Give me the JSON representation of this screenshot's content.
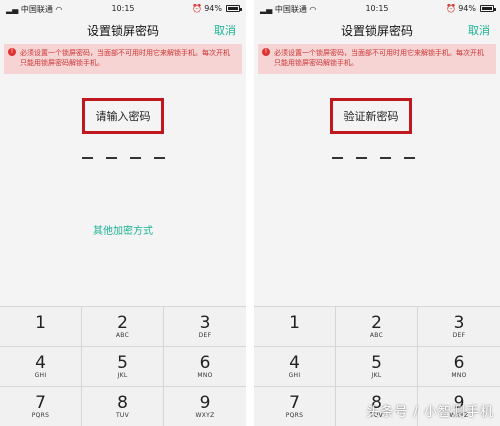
{
  "left": {
    "status": {
      "carrier": "中国联通",
      "time": "10:15",
      "battery": "94%"
    },
    "title": "设置锁屏密码",
    "cancel": "取消",
    "warning": "必须设置一个锁屏密码，当面部不可用时用它来解锁手机。每次开机只能用锁屏密码解锁手机。",
    "prompt": "请输入密码",
    "other_methods": "其他加密方式",
    "keys": [
      {
        "num": "1",
        "letters": ""
      },
      {
        "num": "2",
        "letters": "ABC"
      },
      {
        "num": "3",
        "letters": "DEF"
      },
      {
        "num": "4",
        "letters": "GHI"
      },
      {
        "num": "5",
        "letters": "JKL"
      },
      {
        "num": "6",
        "letters": "MNO"
      },
      {
        "num": "7",
        "letters": "PQRS"
      },
      {
        "num": "8",
        "letters": "TUV"
      },
      {
        "num": "9",
        "letters": "WXYZ"
      }
    ]
  },
  "right": {
    "status": {
      "carrier": "中国联通",
      "time": "10:15",
      "battery": "94%"
    },
    "title": "设置锁屏密码",
    "cancel": "取消",
    "warning": "必须设置一个锁屏密码，当面部不可用时用它来解锁手机。每次开机只能用锁屏密码解锁手机。",
    "prompt": "验证新密码",
    "keys": [
      {
        "num": "1",
        "letters": ""
      },
      {
        "num": "2",
        "letters": "ABC"
      },
      {
        "num": "3",
        "letters": "DEF"
      },
      {
        "num": "4",
        "letters": "GHI"
      },
      {
        "num": "5",
        "letters": "JKL"
      },
      {
        "num": "6",
        "letters": "MNO"
      },
      {
        "num": "7",
        "letters": "PQRS"
      },
      {
        "num": "8",
        "letters": "TUV"
      },
      {
        "num": "9",
        "letters": "WXYZ"
      }
    ]
  },
  "watermark": "头条号 / 小智测手机",
  "colors": {
    "accent": "#1ab394",
    "highlight": "#c0161e",
    "warning_bg": "#f7d4d4",
    "warning_text": "#cc3333"
  },
  "icons": [
    "signal-icon",
    "wifi-icon",
    "alarm-icon",
    "battery-icon",
    "warning-icon"
  ]
}
